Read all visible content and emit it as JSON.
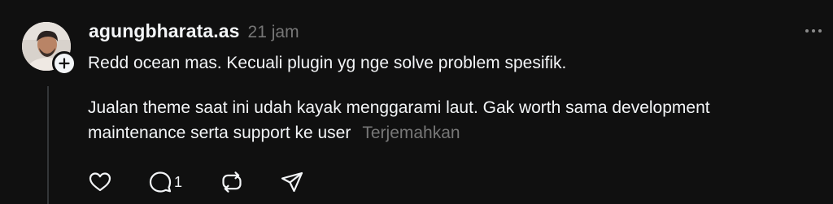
{
  "post": {
    "username": "agungbharata.as",
    "timestamp": "21 jam",
    "paragraphs": [
      "Redd ocean mas. Kecuali plugin yg nge solve problem spesifik.",
      "Jualan theme saat ini udah kayak menggarami laut. Gak worth sama development maintenance serta support ke user"
    ],
    "translate_label": "Terjemahkan",
    "reply_count": "1"
  },
  "icons": {
    "avatar": "user-avatar-photo",
    "follow": "plus-icon",
    "more": "more-horizontal-icon",
    "like": "heart-icon",
    "reply": "comment-icon",
    "repost": "repost-icon",
    "share": "send-icon"
  },
  "colors": {
    "background": "#101010",
    "text": "#f3f5f7",
    "muted": "#777777",
    "thread_line": "#333638"
  }
}
